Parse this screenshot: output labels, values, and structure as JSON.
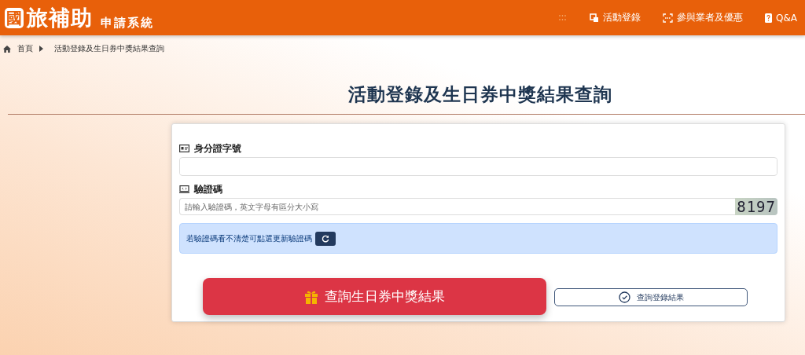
{
  "header": {
    "logo_mark": "國",
    "logo_title": "旅補助",
    "logo_subtitle": "申請系統",
    "nav": [
      {
        "label": "活動登錄",
        "kind": "copy"
      },
      {
        "label": "參與業者及優惠",
        "kind": "scan"
      },
      {
        "label": "Q&A",
        "kind": "question"
      }
    ]
  },
  "breadcrumb": [
    {
      "label": "首頁"
    },
    {
      "label": "活動登錄及生日券中獎結果查詢"
    }
  ],
  "page_title": "活動登錄及生日券中獎結果查詢",
  "form": {
    "id_label": "身分證字號",
    "captcha_label": "驗證碼",
    "captcha_placeholder": "請輸入驗證碼，英文字母有區分大小寫",
    "captcha_code": "8197",
    "notice": "若驗證碼看不清楚可點選更新驗證碼",
    "buttons": [
      {
        "label": "查詢生日券中獎結果",
        "kind": "primary"
      },
      {
        "label": "查詢登錄結果",
        "kind": "outline"
      }
    ]
  }
}
